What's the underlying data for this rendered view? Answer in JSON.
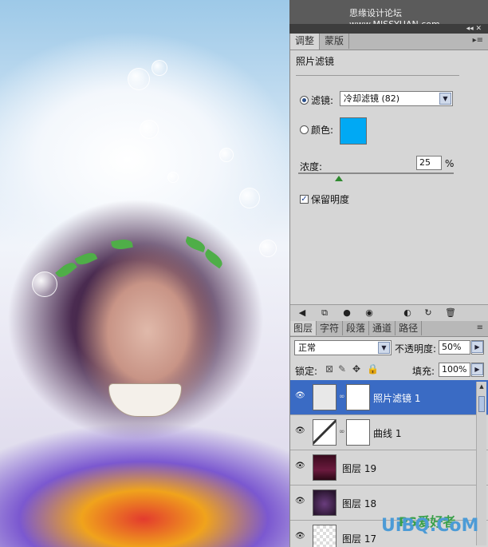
{
  "watermark_top": "思缘设计论坛 www.MISSYUAN.com",
  "adjustments": {
    "tabs": [
      "调整",
      "蒙版"
    ],
    "panel_title": "照片滤镜",
    "filter_label": "滤镜:",
    "filter_value": "冷却滤镜 (82)",
    "color_label": "颜色:",
    "color_swatch": "#00a9f4",
    "density_label": "浓度:",
    "density_value": "25",
    "density_unit": "%",
    "density_level_percent": 25,
    "preserve_label": "保留明度",
    "preserve_checked": true
  },
  "layers_panel": {
    "tabs": [
      "图层",
      "字符",
      "段落",
      "通道",
      "路径"
    ],
    "blend_mode": "正常",
    "opacity_label": "不透明度:",
    "opacity_value": "50%",
    "lock_label": "锁定:",
    "fill_label": "填充:",
    "fill_value": "100%",
    "layers": [
      {
        "name": "照片滤镜 1",
        "selected": true
      },
      {
        "name": "曲线 1",
        "selected": false
      },
      {
        "name": "图层 19",
        "selected": false
      },
      {
        "name": "图层 18",
        "selected": false
      },
      {
        "name": "图层 17",
        "selected": false
      }
    ]
  },
  "watermark_bottom": "UiBQ.CoM",
  "watermark_bottom2": "PS爱好者"
}
